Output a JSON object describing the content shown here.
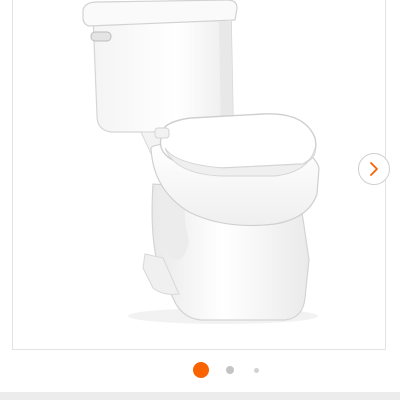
{
  "gallery": {
    "image_name": "two-piece-toilet-photo",
    "slide_count": 3,
    "active_slide": 1,
    "next_icon": "chevron-right-icon"
  },
  "colors": {
    "accent": "#f96302",
    "dot_inactive": "#c4c4c4",
    "dot_far": "#d2d2d2",
    "frame_border": "#e3e3e3",
    "chevron": "#f96302"
  }
}
